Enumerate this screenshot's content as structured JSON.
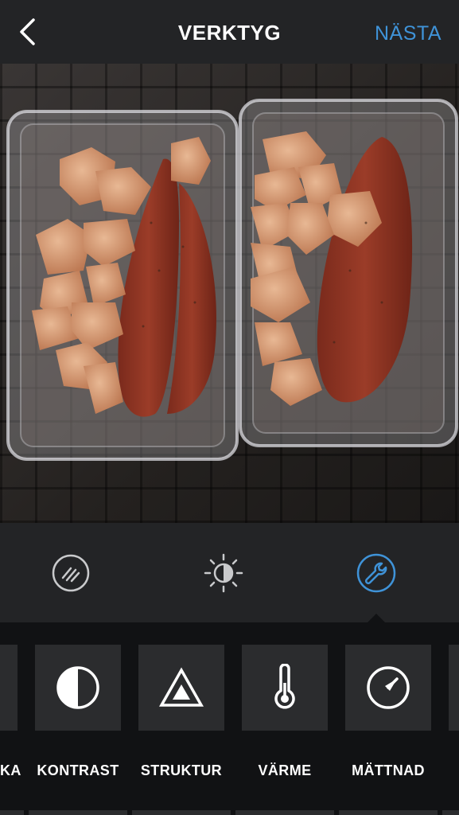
{
  "header": {
    "title": "VERKTYG",
    "next_label": "NÄSTA",
    "accent_color": "#3f93d8"
  },
  "photo": {
    "subject": "two containers with chicken and sweet potato"
  },
  "modes": [
    {
      "icon": "filter-icon",
      "active": false
    },
    {
      "icon": "brightness-icon",
      "active": false
    },
    {
      "icon": "wrench-icon",
      "active": true
    }
  ],
  "tools": [
    {
      "label": "KA",
      "icon": "partial-icon"
    },
    {
      "label": "KONTRAST",
      "icon": "contrast-icon"
    },
    {
      "label": "STRUKTUR",
      "icon": "structure-icon"
    },
    {
      "label": "VÄRME",
      "icon": "thermometer-icon"
    },
    {
      "label": "MÄTTNAD",
      "icon": "saturation-icon"
    }
  ]
}
